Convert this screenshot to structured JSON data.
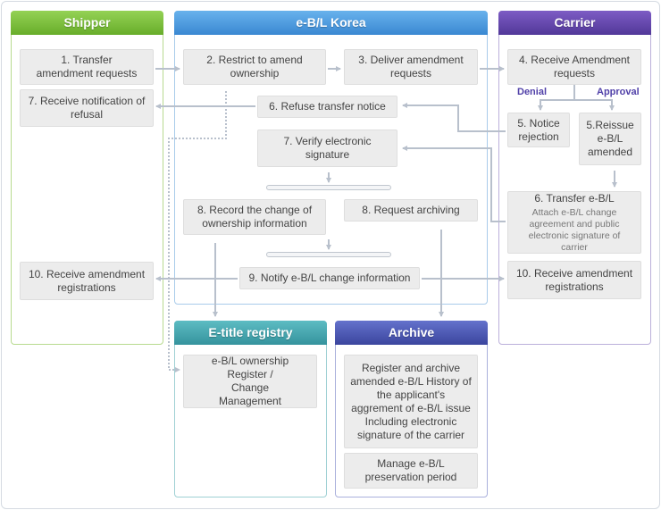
{
  "colors": {
    "shipper": "#7bbf3a",
    "korea": "#4a9be0",
    "carrier": "#6447ae",
    "registry": "#45a6ae",
    "archive": "#4a56b4",
    "connector": "#b8c0cc"
  },
  "shipper": {
    "title": "Shipper",
    "s1": "1. Transfer amendment requests",
    "s7": "7. Receive notification of refusal",
    "s10": "10. Receive amendment registrations"
  },
  "korea": {
    "title": "e-B/L Korea",
    "k2": "2. Restrict to amend ownership",
    "k3": "3.  Deliver amendment requests",
    "k6": "6. Refuse transfer notice",
    "k7": "7. Verify electronic signature",
    "k8a": "8. Record the change of ownership information",
    "k8b": "8. Request archiving",
    "k9": "9. Notify e-B/L change information"
  },
  "carrier": {
    "title": "Carrier",
    "c4": "4. Receive Amendment requests",
    "denial": "Denial",
    "approval": "Approval",
    "c5a": "5. Notice rejection",
    "c5b": "5.Reissue e-B/L amended",
    "c6_title": "6. Transfer e-B/L",
    "c6_sub": "Attach e-B/L change agreement and public electronic signature of carrier",
    "c10": "10. Receive amendment registrations"
  },
  "registry": {
    "title": "E-title registry",
    "box": "e-B/L ownership Register / Change Management"
  },
  "archive": {
    "title": "Archive",
    "box1": "Register and archive amended e-B/L History of the applicant's aggrement of e-B/L issue Including electronic signature of the carrier",
    "box2": "Manage e-B/L preservation period"
  }
}
